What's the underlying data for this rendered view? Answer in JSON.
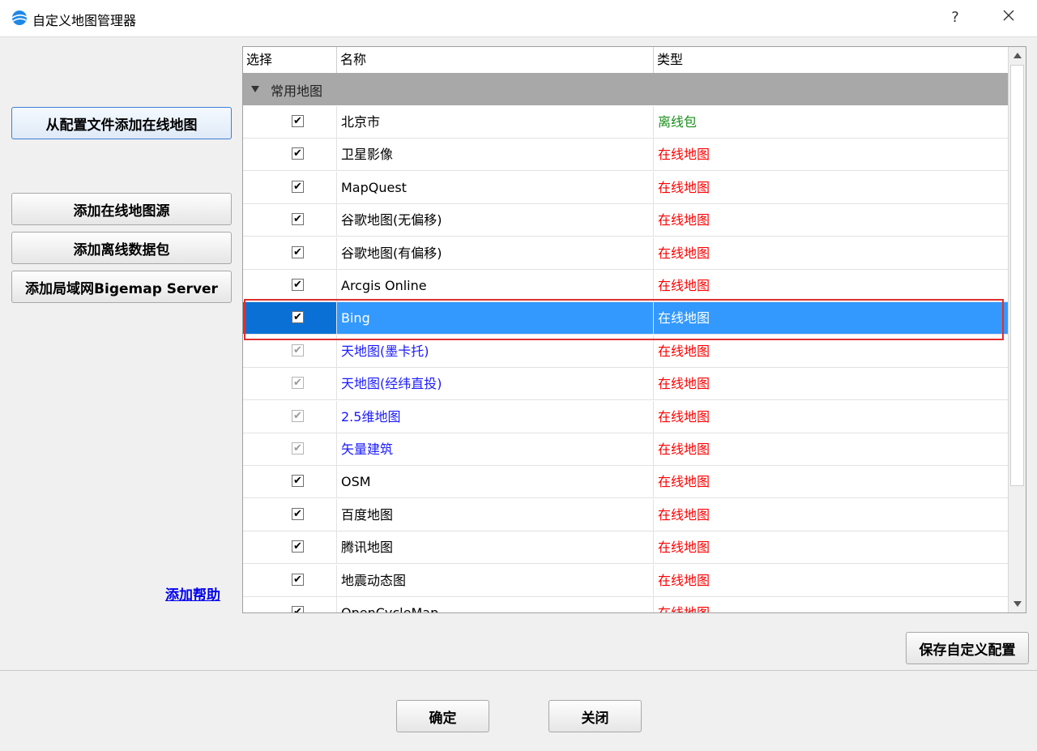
{
  "window": {
    "title": "自定义地图管理器",
    "help": "?",
    "close": "✕",
    "icon": "globe-icon"
  },
  "left_buttons": {
    "add_from_config": "从配置文件添加在线地图",
    "add_online_source": "添加在线地图源",
    "add_offline_package": "添加离线数据包",
    "add_lan_server": "添加局域网Bigemap Server"
  },
  "help_link": "添加帮助",
  "table": {
    "columns": [
      "选择",
      "名称",
      "类型"
    ],
    "group": "常用地图",
    "rows": [
      {
        "checked": true,
        "dim": false,
        "name": "北京市",
        "type": "离线包",
        "name_color": "#000000",
        "type_color": "#1a8f1a"
      },
      {
        "checked": true,
        "dim": false,
        "name": "卫星影像",
        "type": "在线地图",
        "name_color": "#000000",
        "type_color": "#ff0000"
      },
      {
        "checked": true,
        "dim": false,
        "name": "MapQuest",
        "type": "在线地图",
        "name_color": "#000000",
        "type_color": "#ff0000"
      },
      {
        "checked": true,
        "dim": false,
        "name": "谷歌地图(无偏移)",
        "type": "在线地图",
        "name_color": "#000000",
        "type_color": "#ff0000"
      },
      {
        "checked": true,
        "dim": false,
        "name": "谷歌地图(有偏移)",
        "type": "在线地图",
        "name_color": "#000000",
        "type_color": "#ff0000"
      },
      {
        "checked": true,
        "dim": false,
        "name": "Arcgis Online",
        "type": "在线地图",
        "name_color": "#000000",
        "type_color": "#ff0000"
      },
      {
        "checked": true,
        "dim": false,
        "name": "Bing",
        "type": "在线地图",
        "name_color": "#ffffff",
        "type_color": "#ffffff",
        "selected": true
      },
      {
        "checked": true,
        "dim": true,
        "name": "天地图(墨卡托)",
        "type": "在线地图",
        "name_color": "#1a1aff",
        "type_color": "#ff0000"
      },
      {
        "checked": true,
        "dim": true,
        "name": "天地图(经纬直投)",
        "type": "在线地图",
        "name_color": "#1a1aff",
        "type_color": "#ff0000"
      },
      {
        "checked": true,
        "dim": true,
        "name": "2.5维地图",
        "type": "在线地图",
        "name_color": "#1a1aff",
        "type_color": "#ff0000"
      },
      {
        "checked": true,
        "dim": true,
        "name": "矢量建筑",
        "type": "在线地图",
        "name_color": "#1a1aff",
        "type_color": "#ff0000"
      },
      {
        "checked": true,
        "dim": false,
        "name": "OSM",
        "type": "在线地图",
        "name_color": "#000000",
        "type_color": "#ff0000"
      },
      {
        "checked": true,
        "dim": false,
        "name": "百度地图",
        "type": "在线地图",
        "name_color": "#000000",
        "type_color": "#ff0000"
      },
      {
        "checked": true,
        "dim": false,
        "name": "腾讯地图",
        "type": "在线地图",
        "name_color": "#000000",
        "type_color": "#ff0000"
      },
      {
        "checked": true,
        "dim": false,
        "name": "地震动态图",
        "type": "在线地图",
        "name_color": "#000000",
        "type_color": "#ff0000"
      },
      {
        "checked": true,
        "dim": false,
        "name": "OpenCycleMap",
        "type": "在线地图",
        "name_color": "#000000",
        "type_color": "#ff0000"
      }
    ]
  },
  "save_config": "保存自定义配置",
  "footer": {
    "ok": "确定",
    "close": "关闭"
  },
  "checkmark": "✔"
}
